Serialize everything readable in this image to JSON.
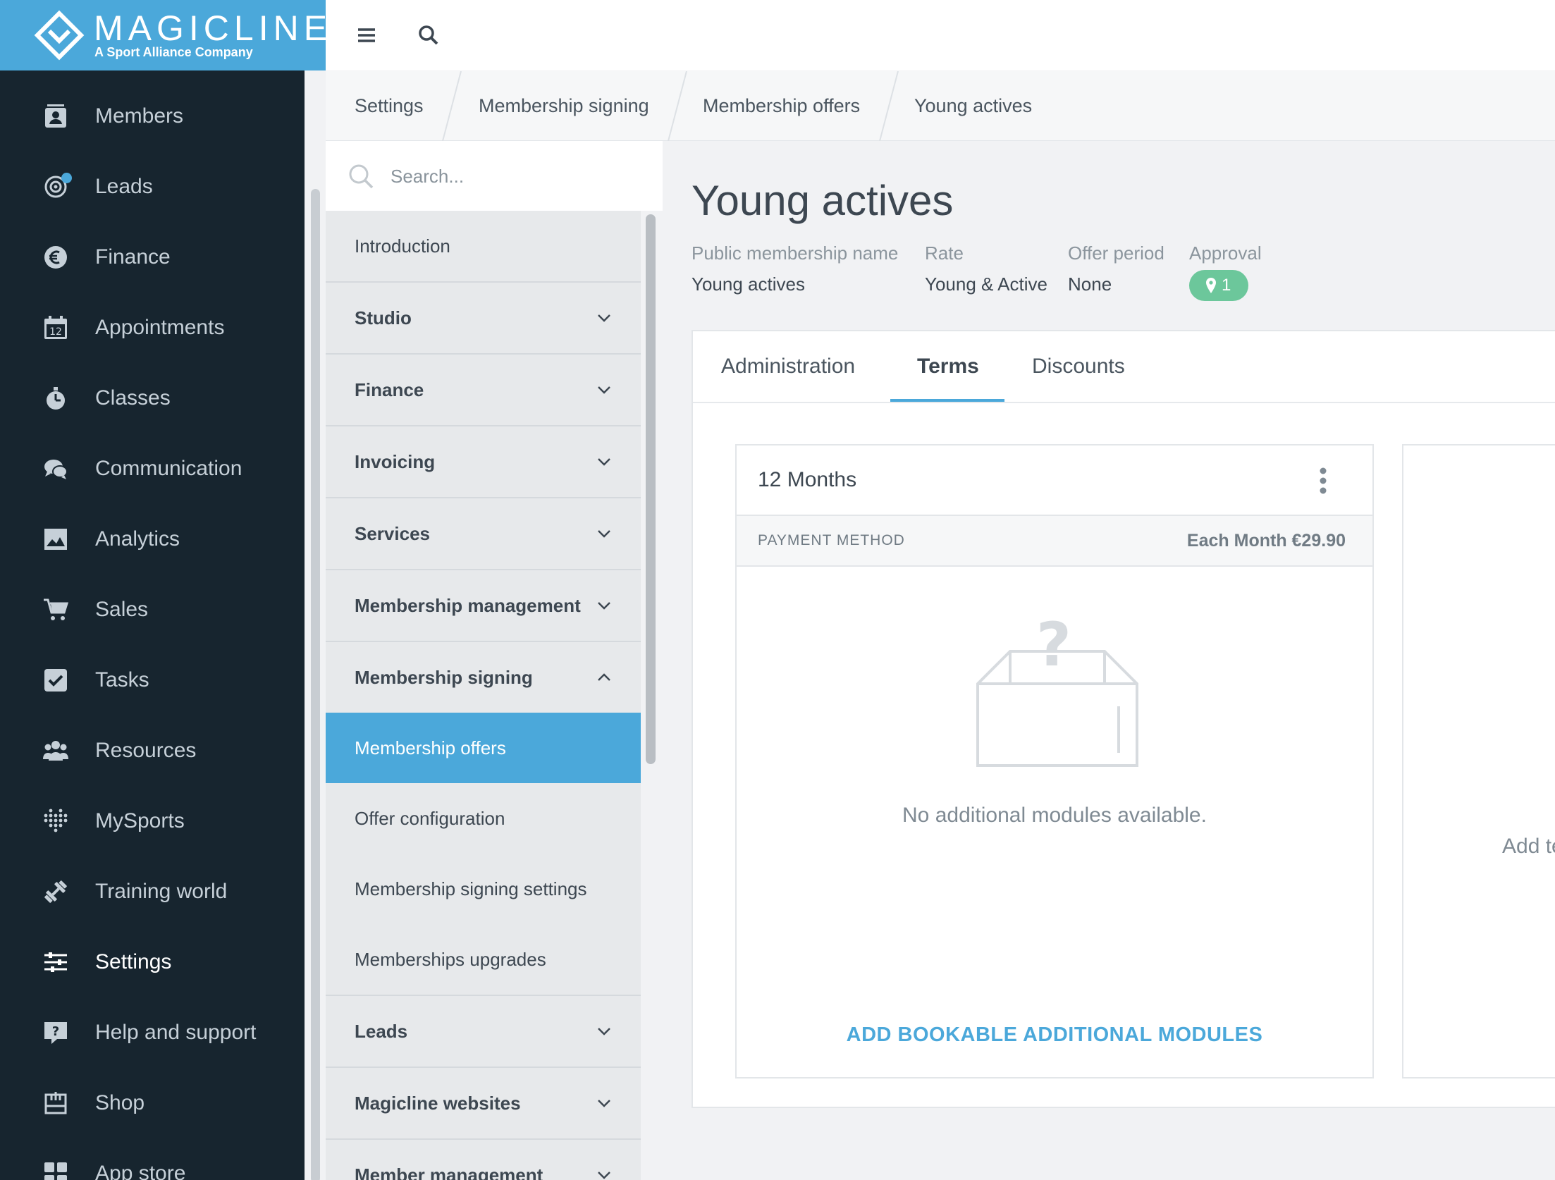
{
  "brand": {
    "name": "MAGICLINE",
    "tagline": "A Sport Alliance Company"
  },
  "nav": [
    {
      "label": "Members",
      "icon": "members-icon"
    },
    {
      "label": "Leads",
      "icon": "leads-icon"
    },
    {
      "label": "Finance",
      "icon": "euro-icon"
    },
    {
      "label": "Appointments",
      "icon": "calendar-icon"
    },
    {
      "label": "Classes",
      "icon": "stopwatch-icon"
    },
    {
      "label": "Communication",
      "icon": "chat-icon"
    },
    {
      "label": "Analytics",
      "icon": "chart-image-icon"
    },
    {
      "label": "Sales",
      "icon": "cart-icon"
    },
    {
      "label": "Tasks",
      "icon": "checkbox-icon"
    },
    {
      "label": "Resources",
      "icon": "group-icon"
    },
    {
      "label": "MySports",
      "icon": "dots-grid-icon"
    },
    {
      "label": "Training world",
      "icon": "dumbbell-icon"
    },
    {
      "label": "Settings",
      "icon": "sliders-icon"
    },
    {
      "label": "Help and support",
      "icon": "help-icon"
    },
    {
      "label": "Shop",
      "icon": "shop-icon"
    },
    {
      "label": "App store",
      "icon": "apps-icon"
    }
  ],
  "breadcrumb": [
    "Settings",
    "Membership signing",
    "Membership offers",
    "Young actives"
  ],
  "menu": {
    "search_placeholder": "Search...",
    "items": [
      {
        "label": "Introduction"
      },
      {
        "label": "Studio"
      },
      {
        "label": "Finance"
      },
      {
        "label": "Invoicing"
      },
      {
        "label": "Services"
      },
      {
        "label": "Membership management"
      },
      {
        "label": "Membership signing"
      }
    ],
    "subitems": [
      {
        "label": "Membership offers"
      },
      {
        "label": "Offer configuration"
      },
      {
        "label": "Membership signing settings"
      },
      {
        "label": "Memberships upgrades"
      }
    ],
    "items_after": [
      {
        "label": "Leads"
      },
      {
        "label": "Magicline websites"
      },
      {
        "label": "Member management"
      }
    ]
  },
  "offer": {
    "title": "Young actives",
    "meta": {
      "public_name_label": "Public membership name",
      "public_name": "Young actives",
      "rate_label": "Rate",
      "rate": "Young & Active",
      "period_label": "Offer period",
      "period": "None",
      "approval_label": "Approval",
      "approval_count": "1"
    },
    "tabs": [
      "Administration",
      "Terms",
      "Discounts"
    ],
    "active_tab": "Terms",
    "term": {
      "title": "12 Months",
      "payment_label": "PAYMENT METHOD",
      "payment_value": "Each Month €29.90",
      "empty_text": "No additional modules available.",
      "add_link": "ADD BOOKABLE ADDITIONAL MODULES"
    },
    "add_term_text": "Add te"
  },
  "colors": {
    "brand": "#4ba8da",
    "sidebar": "#17252f",
    "approval": "#6cc79b"
  }
}
